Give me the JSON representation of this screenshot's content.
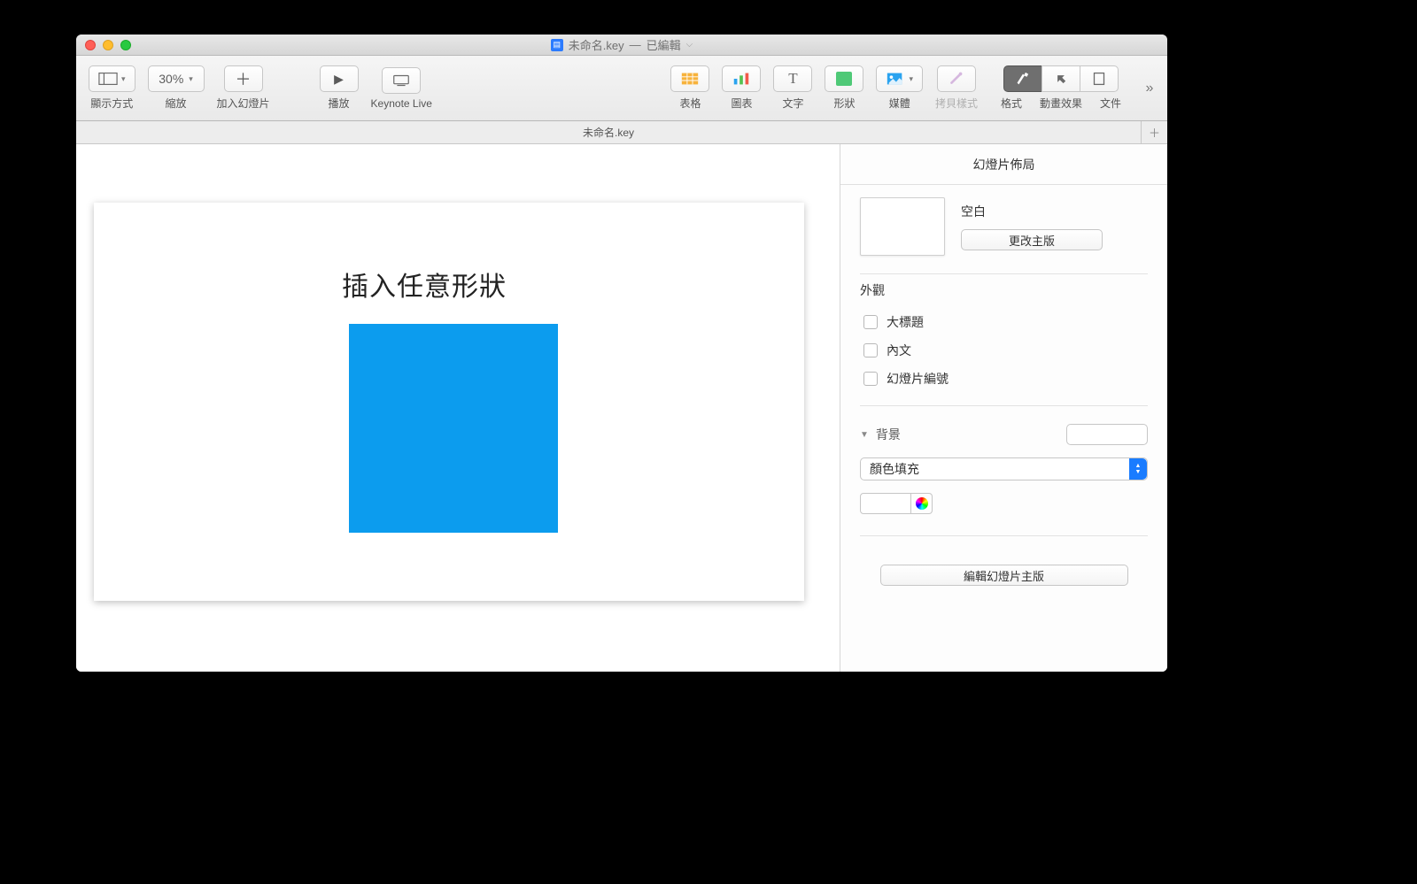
{
  "title": {
    "appicon": "▦",
    "filename": "未命名.key",
    "sep": "—",
    "status": "已編輯"
  },
  "toolbar": {
    "view": "顯示方式",
    "zoom_value": "30%",
    "zoom": "縮放",
    "add_slide": "加入幻燈片",
    "play": "播放",
    "keynote_live": "Keynote Live",
    "table": "表格",
    "chart": "圖表",
    "text": "文字",
    "shape": "形狀",
    "media": "媒體",
    "copy_style": "拷貝樣式",
    "format": "格式",
    "animate": "動畫效果",
    "document": "文件"
  },
  "tab": {
    "name": "未命名.key"
  },
  "slide": {
    "title": "插入任意形狀",
    "shape_color": "#0c9cee"
  },
  "inspector": {
    "header": "幻燈片佈局",
    "layout_name": "空白",
    "change_master": "更改主版",
    "appearance": "外觀",
    "chk_title": "大標題",
    "chk_body": "內文",
    "chk_slideno": "幻燈片編號",
    "background": "背景",
    "fill_type": "顏色填充",
    "edit_master": "編輯幻燈片主版"
  }
}
